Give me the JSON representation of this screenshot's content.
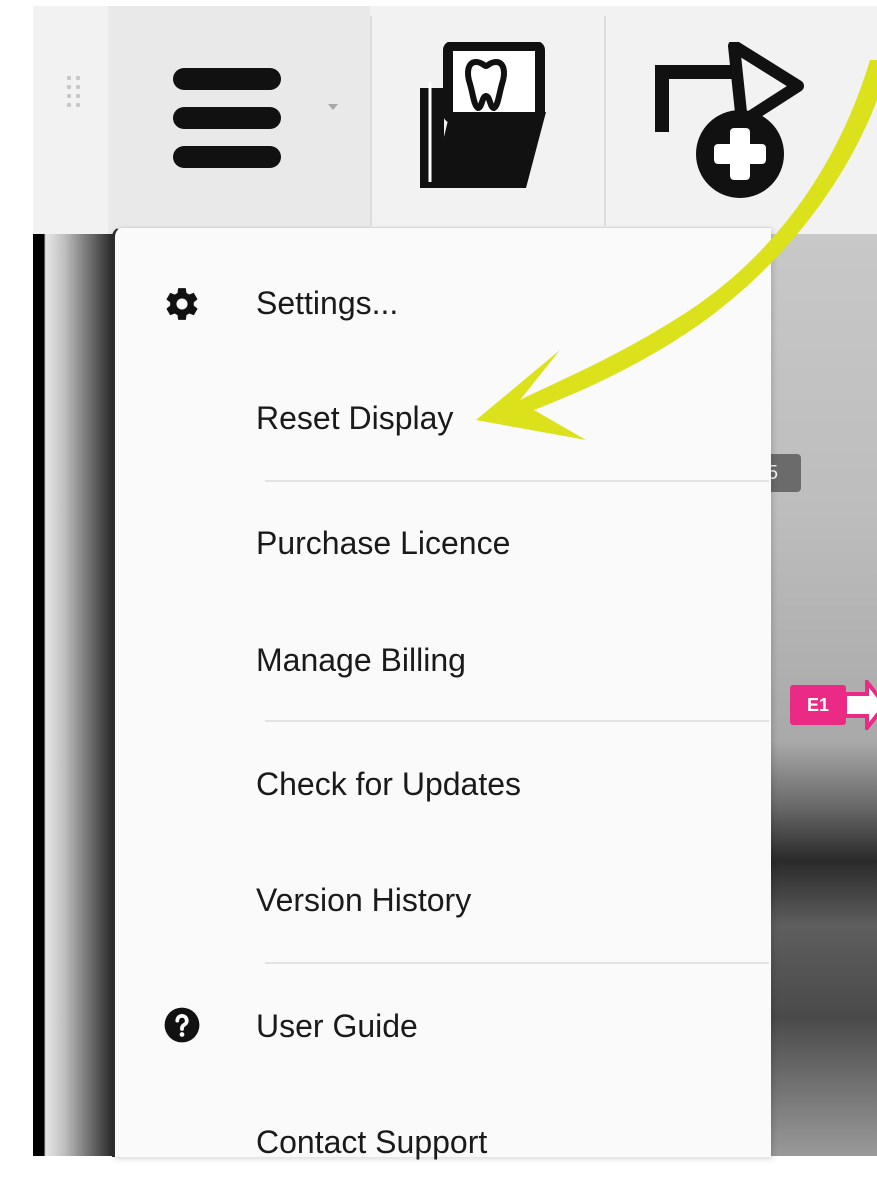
{
  "toolbar": {
    "items": [
      {
        "name": "drag-handle",
        "icon": "grip-icon"
      },
      {
        "name": "main-menu",
        "icon": "hamburger-icon",
        "has_dropdown": true
      },
      {
        "name": "open-images",
        "icon": "tooth-folder-icon"
      },
      {
        "name": "new-export",
        "icon": "export-add-icon"
      }
    ]
  },
  "menu": {
    "items": [
      {
        "label": "Settings...",
        "icon": "gear-icon"
      },
      {
        "label": "Reset Display"
      },
      {
        "label": "Purchase Licence"
      },
      {
        "label": "Manage Billing"
      },
      {
        "label": "Check for Updates"
      },
      {
        "label": "Version History"
      },
      {
        "label": "User Guide",
        "icon": "question-icon"
      },
      {
        "label": "Contact Support"
      }
    ]
  },
  "viewer": {
    "badges": [
      {
        "label": "5",
        "color": "#6b6b6b"
      },
      {
        "label": "E1",
        "color": "#ea2a84"
      }
    ]
  },
  "annotation": {
    "arrow_color": "#dbe21c",
    "points_to": "Reset Display"
  }
}
